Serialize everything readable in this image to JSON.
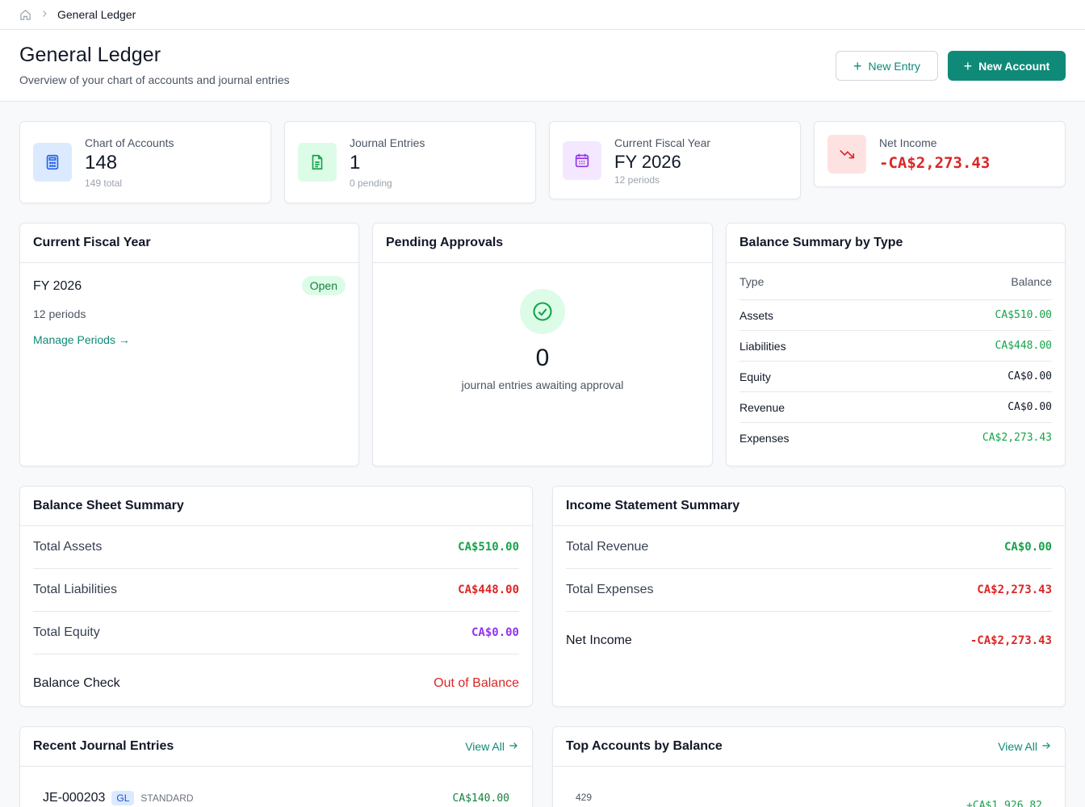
{
  "breadcrumb": {
    "current": "General Ledger"
  },
  "header": {
    "title": "General Ledger",
    "subtitle": "Overview of your chart of accounts and journal entries",
    "new_entry": "New Entry",
    "new_account": "New Account"
  },
  "stats": [
    {
      "label": "Chart of Accounts",
      "value": "148",
      "meta": "149 total",
      "icon": "calculator-icon"
    },
    {
      "label": "Journal Entries",
      "value": "1",
      "meta": "0 pending",
      "icon": "document-icon"
    },
    {
      "label": "Current Fiscal Year",
      "value": "FY 2026",
      "meta": "12 periods",
      "icon": "calendar-icon"
    },
    {
      "label": "Net Income",
      "value": "-CA$2,273.43",
      "icon": "trending-down-icon"
    }
  ],
  "fiscal": {
    "title": "Current Fiscal Year",
    "name": "FY 2026",
    "status": "Open",
    "periods": "12 periods",
    "link": "Manage Periods →"
  },
  "pending": {
    "title": "Pending Approvals",
    "count": "0",
    "text": "journal entries awaiting approval"
  },
  "balance_type": {
    "title": "Balance Summary by Type",
    "col_type": "Type",
    "col_balance": "Balance",
    "rows": [
      {
        "type": "Assets",
        "balance": "CA$510.00"
      },
      {
        "type": "Liabilities",
        "balance": "CA$448.00"
      },
      {
        "type": "Equity",
        "balance": "CA$0.00"
      },
      {
        "type": "Revenue",
        "balance": "CA$0.00"
      },
      {
        "type": "Expenses",
        "balance": "CA$2,273.43"
      }
    ]
  },
  "balance_sheet": {
    "title": "Balance Sheet Summary",
    "rows": [
      {
        "label": "Total Assets",
        "value": "CA$510.00"
      },
      {
        "label": "Total Liabilities",
        "value": "CA$448.00"
      },
      {
        "label": "Total Equity",
        "value": "CA$0.00"
      }
    ],
    "check_label": "Balance Check",
    "check_value": "Out of Balance"
  },
  "income": {
    "title": "Income Statement Summary",
    "rows": [
      {
        "label": "Total Revenue",
        "value": "CA$0.00"
      },
      {
        "label": "Total Expenses",
        "value": "CA$2,273.43"
      }
    ],
    "net_label": "Net Income",
    "net_value": "-CA$2,273.43"
  },
  "recent": {
    "title": "Recent Journal Entries",
    "view_all": "View All",
    "entry": {
      "id": "JE-000203",
      "tag": "GL",
      "type": "STANDARD",
      "amount": "CA$140.00"
    }
  },
  "top": {
    "title": "Top Accounts by Balance",
    "view_all": "View All",
    "first_code": "429",
    "first_amount": "+CA$1,926.82"
  },
  "colors": {
    "accent": "#0f8a78",
    "positive": "#16a34a",
    "negative": "#dc2626",
    "equity": "#9333ea"
  }
}
